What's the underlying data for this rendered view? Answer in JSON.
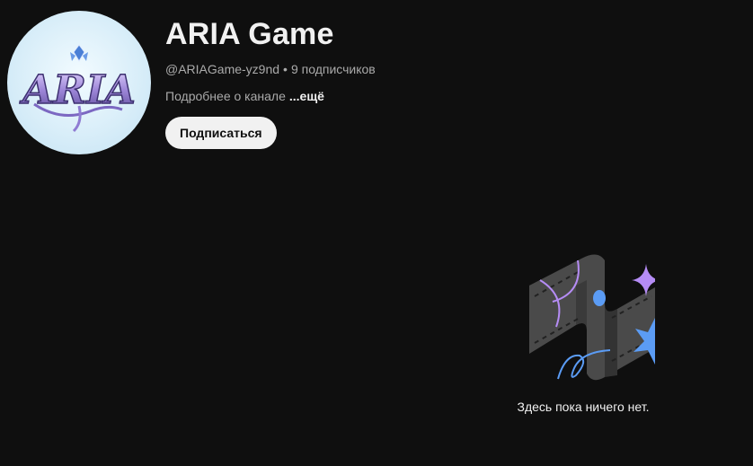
{
  "channel": {
    "title": "ARIA Game",
    "handle": "@ARIAGame-yz9nd",
    "separator": "•",
    "subscribers": "9 подписчиков",
    "about_label": "Подробнее о канале",
    "about_more": "...ещё",
    "subscribe_label": "Подписаться",
    "avatar_logo": "ARIA"
  },
  "empty_state": {
    "message": "Здесь пока ничего нет.",
    "icon": "empty-content-illustration"
  },
  "colors": {
    "background": "#0f0f0f",
    "text_primary": "#f1f1f1",
    "text_secondary": "#aaaaaa",
    "button_bg": "#f1f1f1",
    "accent_purple": "#b58cf5",
    "accent_blue": "#5b9cf5"
  }
}
